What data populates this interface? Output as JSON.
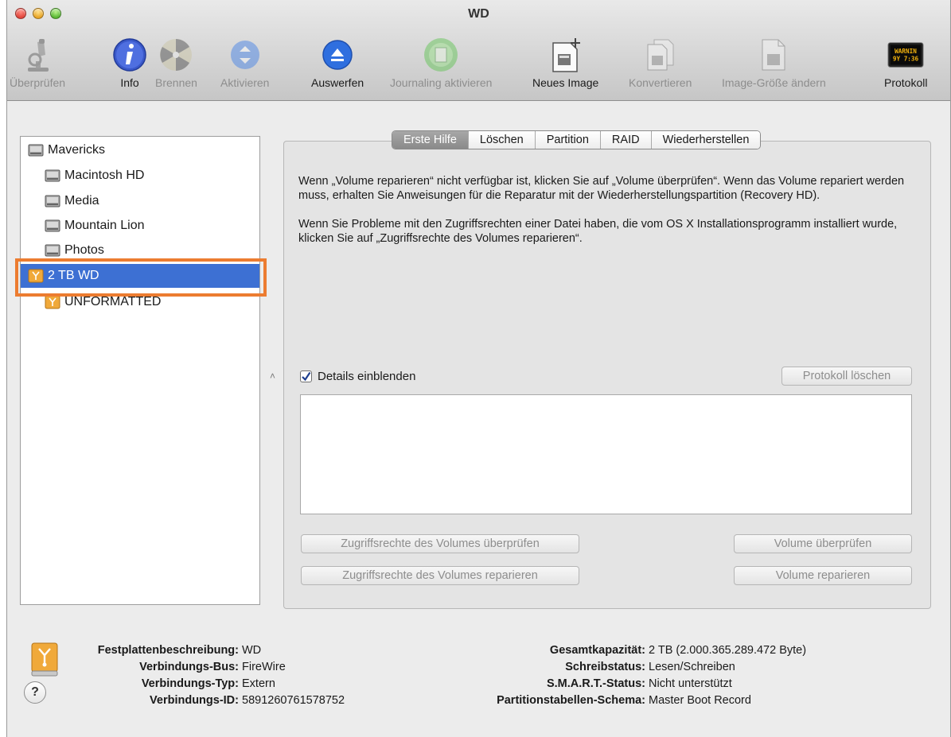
{
  "window": {
    "title": "WD"
  },
  "toolbar": {
    "items": [
      {
        "label": "Überprüfen",
        "icon": "microscope-icon",
        "enabled": false
      },
      {
        "label": "Info",
        "icon": "info-icon",
        "enabled": true
      },
      {
        "label": "Brennen",
        "icon": "burn-icon",
        "enabled": false
      },
      {
        "label": "Aktivieren",
        "icon": "mount-icon",
        "enabled": false
      },
      {
        "label": "Auswerfen",
        "icon": "eject-icon",
        "enabled": true
      },
      {
        "label": "Journaling aktivieren",
        "icon": "journaling-icon",
        "enabled": false
      },
      {
        "label": "Neues Image",
        "icon": "new-image-icon",
        "enabled": true
      },
      {
        "label": "Konvertieren",
        "icon": "convert-icon",
        "enabled": false
      },
      {
        "label": "Image-Größe ändern",
        "icon": "resize-image-icon",
        "enabled": false
      },
      {
        "label": "Protokoll",
        "icon": "log-icon",
        "enabled": true,
        "icon_text": "WARNIN\n9Y 7:36"
      }
    ]
  },
  "sidebar": {
    "items": [
      {
        "label": "Mavericks",
        "type": "disk",
        "selected": false
      },
      {
        "label": "Macintosh HD",
        "type": "volume",
        "selected": false
      },
      {
        "label": "Media",
        "type": "volume",
        "selected": false
      },
      {
        "label": "Mountain Lion",
        "type": "volume",
        "selected": false
      },
      {
        "label": "Photos",
        "type": "volume",
        "selected": false
      },
      {
        "label": "2 TB WD",
        "type": "disk",
        "selected": true
      },
      {
        "label": "UNFORMATTED",
        "type": "volume",
        "selected": false
      }
    ]
  },
  "tabs": [
    {
      "label": "Erste Hilfe",
      "active": true
    },
    {
      "label": "Löschen",
      "active": false
    },
    {
      "label": "Partition",
      "active": false
    },
    {
      "label": "RAID",
      "active": false
    },
    {
      "label": "Wiederherstellen",
      "active": false
    }
  ],
  "first_aid": {
    "paragraph1": "Wenn „Volume reparieren“ nicht verfügbar ist, klicken Sie auf „Volume überprüfen“. Wenn das Volume repariert werden muss, erhalten Sie Anweisungen für die Reparatur mit der Wiederherstellungspartition (Recovery HD).",
    "paragraph2": "Wenn Sie Probleme mit den Zugriffsrechten einer Datei haben, die vom OS X Installationsprogramm installiert wurde, klicken Sie auf „Zugriffsrechte des Volumes reparieren“.",
    "show_details_label": "Details einblenden",
    "show_details_checked": true,
    "clear_log_label": "Protokoll löschen",
    "verify_permissions_label": "Zugriffsrechte des Volumes überprüfen",
    "repair_permissions_label": "Zugriffsrechte des Volumes reparieren",
    "verify_volume_label": "Volume überprüfen",
    "repair_volume_label": "Volume reparieren",
    "log_text": ""
  },
  "info": {
    "left": [
      {
        "key": "Festplattenbeschreibung:",
        "value": "WD"
      },
      {
        "key": "Verbindungs-Bus:",
        "value": "FireWire"
      },
      {
        "key": "Verbindungs-Typ:",
        "value": "Extern"
      },
      {
        "key": "Verbindungs-ID:",
        "value": "5891260761578752"
      }
    ],
    "right": [
      {
        "key": "Gesamtkapazität:",
        "value": "2 TB (2.000.365.289.472 Byte)"
      },
      {
        "key": "Schreibstatus:",
        "value": "Lesen/Schreiben"
      },
      {
        "key": "S.M.A.R.T.-Status:",
        "value": "Nicht unterstützt"
      },
      {
        "key": "Partitionstabellen-Schema:",
        "value": "Master Boot Record"
      }
    ],
    "help_label": "?"
  },
  "colors": {
    "selection": "#3d70d3",
    "highlight_outline": "#ec7c30",
    "firewire_drive": "#f0a93a"
  }
}
